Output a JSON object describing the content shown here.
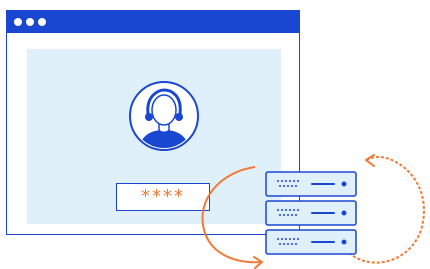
{
  "login": {
    "password_mask": "****"
  },
  "icons": {
    "avatar": "user-avatar-icon",
    "server": "server-rack-icon",
    "sync": "sync-arrows-icon"
  },
  "colors": {
    "brand_blue": "#1a47d1",
    "panel_bg": "#e0f0fb",
    "orange": "#f07a37",
    "server_body": "#e0f0fb"
  }
}
